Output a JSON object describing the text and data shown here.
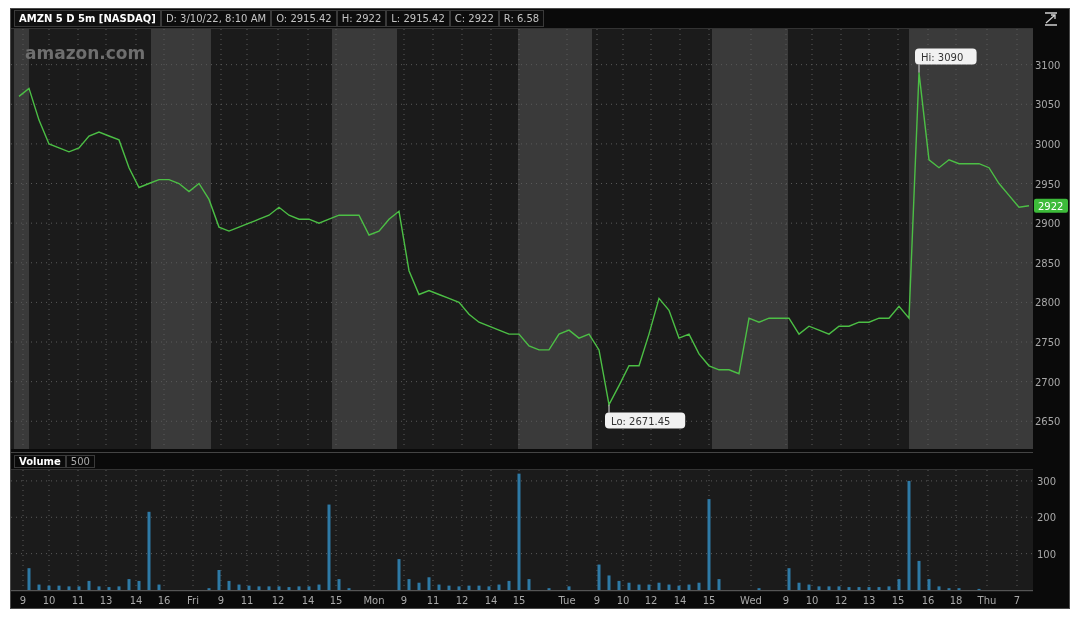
{
  "header": {
    "symbol": "AMZN 5 D 5m [NASDAQ]",
    "readouts": [
      "D: 3/10/22, 8:10 AM",
      "O: 2915.42",
      "H: 2922",
      "L: 2915.42",
      "C: 2922",
      "R: 6.58"
    ]
  },
  "price_pane": {
    "logo_text": "amazon.com",
    "last_price_label": "2922",
    "sessions": [
      {
        "kind": "extended"
      },
      {
        "kind": "regular"
      },
      {
        "kind": "extended"
      },
      {
        "kind": "regular"
      },
      {
        "kind": "extended"
      },
      {
        "kind": "regular"
      },
      {
        "kind": "extended"
      },
      {
        "kind": "regular"
      },
      {
        "kind": "extended"
      },
      {
        "kind": "regular"
      },
      {
        "kind": "extended"
      }
    ],
    "chart_data": {
      "type": "line",
      "grid": true,
      "ylim": [
        2615,
        3145
      ],
      "yticks": [
        2650,
        2700,
        2750,
        2800,
        2850,
        2900,
        2950,
        3000,
        3050,
        3100
      ],
      "series": [
        {
          "color": "#4cbf45",
          "values": [
            3060,
            3070,
            3030,
            3000,
            2995,
            2990,
            2995,
            3010,
            3015,
            3010,
            3005,
            2970,
            2945,
            2950,
            2955,
            2955,
            2950,
            2940,
            2950,
            2930,
            2895,
            2890,
            2895,
            2900,
            2905,
            2910,
            2920,
            2910,
            2905,
            2905,
            2900,
            2905,
            2910,
            2910,
            2910,
            2885,
            2890,
            2905,
            2915,
            2840,
            2810,
            2815,
            2810,
            2805,
            2800,
            2785,
            2775,
            2770,
            2765,
            2760,
            2760,
            2745,
            2740,
            2740,
            2760,
            2765,
            2755,
            2760,
            2740,
            2671,
            2695,
            2720,
            2720,
            2760,
            2805,
            2790,
            2755,
            2760,
            2735,
            2720,
            2715,
            2715,
            2710,
            2780,
            2775,
            2780,
            2780,
            2780,
            2760,
            2770,
            2765,
            2760,
            2770,
            2770,
            2775,
            2775,
            2780,
            2780,
            2795,
            2780,
            3090,
            2980,
            2970,
            2980,
            2975,
            2975,
            2975,
            2970,
            2950,
            2935,
            2920,
            2922
          ]
        }
      ],
      "annotations": [
        "Hi: 3090",
        "Lo: 2671.45"
      ]
    }
  },
  "volume_pane": {
    "title": "Volume",
    "setting": "500",
    "time_axis": [
      "9",
      "10",
      "11",
      "13",
      "14",
      "16",
      "Fri",
      "9",
      "11",
      "12",
      "14",
      "15",
      "Mon",
      "9",
      "11",
      "12",
      "14",
      "15",
      "Tue",
      "9",
      "10",
      "12",
      "14",
      "15",
      "Wed",
      "9",
      "10",
      "12",
      "13",
      "15",
      "16",
      "18",
      "Thu",
      "7"
    ],
    "chart_data": {
      "type": "bar",
      "grid": true,
      "ylim": [
        0,
        330
      ],
      "yticks": [
        100,
        200,
        300
      ],
      "series": [
        {
          "color": "#2e7aa6",
          "values": [
            0,
            60,
            15,
            12,
            12,
            10,
            10,
            25,
            10,
            8,
            10,
            30,
            25,
            215,
            15,
            0,
            0,
            0,
            0,
            5,
            55,
            25,
            15,
            12,
            10,
            10,
            10,
            8,
            10,
            10,
            15,
            235,
            30,
            5,
            0,
            0,
            0,
            0,
            85,
            30,
            20,
            35,
            15,
            12,
            10,
            12,
            12,
            10,
            15,
            25,
            320,
            30,
            0,
            5,
            0,
            10,
            0,
            0,
            70,
            40,
            25,
            20,
            15,
            15,
            20,
            15,
            12,
            15,
            20,
            250,
            30,
            0,
            0,
            0,
            5,
            0,
            0,
            60,
            20,
            15,
            10,
            10,
            10,
            8,
            8,
            8,
            8,
            10,
            30,
            300,
            80,
            30,
            10,
            5,
            5,
            0,
            3,
            0,
            0,
            0,
            0,
            0
          ]
        }
      ]
    }
  }
}
